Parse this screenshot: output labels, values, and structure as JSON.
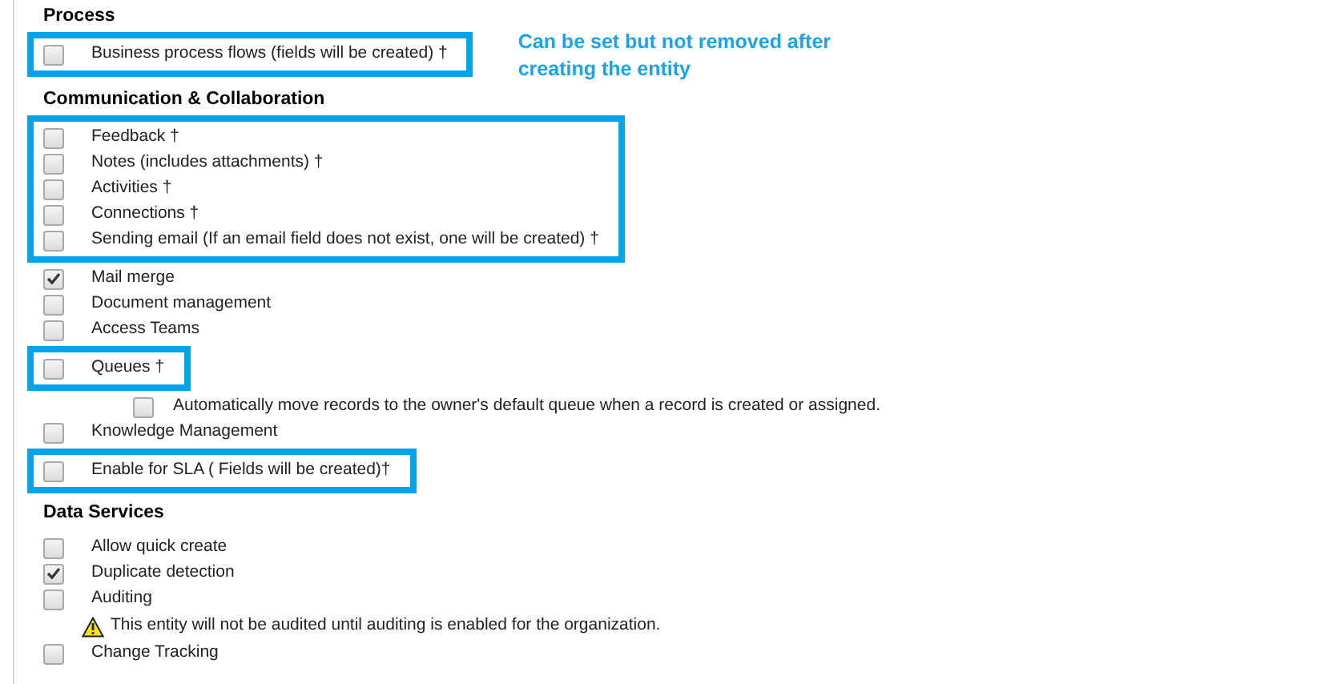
{
  "sections": [
    {
      "title": "Process",
      "groups": [
        {
          "highlighted": true,
          "callout": "Can be set but not removed after creating the entity",
          "items": [
            {
              "kind": "checkbox",
              "label": "Business process flows (fields will be created) †",
              "checked": false
            }
          ]
        }
      ]
    },
    {
      "title": "Communication & Collaboration",
      "groups": [
        {
          "highlighted": true,
          "items": [
            {
              "kind": "checkbox",
              "label": "Feedback †",
              "checked": false
            },
            {
              "kind": "checkbox",
              "label": "Notes (includes attachments) †",
              "checked": false
            },
            {
              "kind": "checkbox",
              "label": "Activities †",
              "checked": false
            },
            {
              "kind": "checkbox",
              "label": "Connections †",
              "checked": false
            },
            {
              "kind": "checkbox",
              "label": "Sending email (If an email field does not exist, one will be created) †",
              "checked": false
            }
          ]
        },
        {
          "highlighted": false,
          "items": [
            {
              "kind": "checkbox",
              "label": "Mail merge",
              "checked": true
            },
            {
              "kind": "checkbox",
              "label": "Document management",
              "checked": false
            },
            {
              "kind": "checkbox",
              "label": "Access Teams",
              "checked": false
            }
          ]
        },
        {
          "highlighted": true,
          "items": [
            {
              "kind": "checkbox",
              "label": "Queues †",
              "checked": false
            }
          ]
        },
        {
          "highlighted": false,
          "items": [
            {
              "kind": "sub-checkbox",
              "label": "Automatically move records to the owner's default queue when a record is created or assigned.",
              "checked": false
            },
            {
              "kind": "checkbox",
              "label": "Knowledge Management",
              "checked": false
            }
          ]
        },
        {
          "highlighted": true,
          "items": [
            {
              "kind": "checkbox",
              "label": "Enable for SLA ( Fields will be created)†",
              "checked": false
            }
          ]
        }
      ]
    },
    {
      "title": "Data Services",
      "groups": [
        {
          "highlighted": false,
          "items": [
            {
              "kind": "checkbox",
              "label": "Allow quick create",
              "checked": false
            },
            {
              "kind": "checkbox",
              "label": "Duplicate detection",
              "checked": true
            },
            {
              "kind": "checkbox",
              "label": "Auditing",
              "checked": false
            },
            {
              "kind": "warning",
              "label": "This entity will not be audited until auditing is enabled for the organization."
            },
            {
              "kind": "checkbox",
              "label": "Change Tracking",
              "checked": false
            }
          ]
        }
      ]
    }
  ]
}
